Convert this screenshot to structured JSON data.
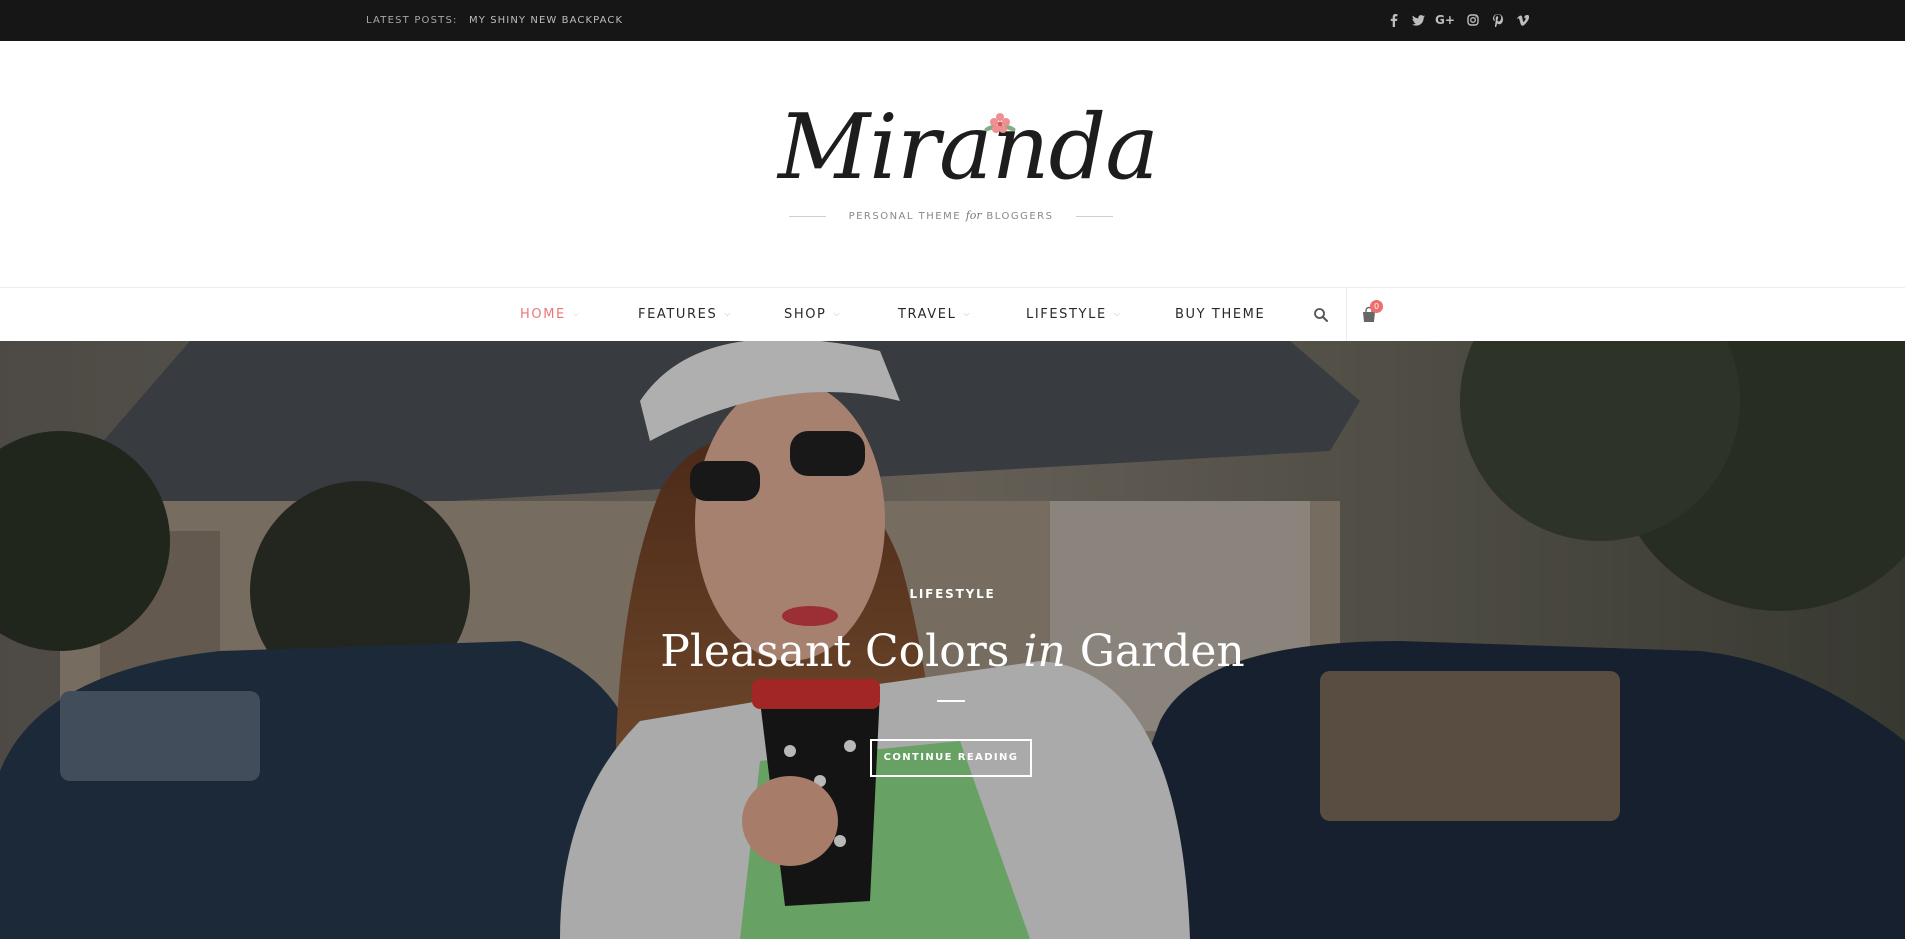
{
  "topbar": {
    "latest_label": "LATEST POSTS:",
    "latest_title": "MY SHINY NEW BACKPACK",
    "social": [
      {
        "icon": "facebook-icon",
        "glyph": "f"
      },
      {
        "icon": "twitter-icon",
        "glyph": "t"
      },
      {
        "icon": "google-plus-icon",
        "glyph": "G+"
      },
      {
        "icon": "instagram-icon",
        "glyph": ""
      },
      {
        "icon": "pinterest-icon",
        "glyph": "P"
      },
      {
        "icon": "vimeo-icon",
        "glyph": "v"
      }
    ]
  },
  "header": {
    "logo": "Miranda",
    "tagline_before": "PERSONAL THEME",
    "tagline_for": "for",
    "tagline_after": "BLOGGERS"
  },
  "nav": {
    "items": [
      {
        "label": "HOME",
        "dropdown": true,
        "active": true
      },
      {
        "label": "FEATURES",
        "dropdown": true
      },
      {
        "label": "SHOP",
        "dropdown": true
      },
      {
        "label": "TRAVEL",
        "dropdown": true
      },
      {
        "label": "LIFESTYLE",
        "dropdown": true
      },
      {
        "label": "BUY THEME",
        "dropdown": false
      }
    ],
    "chevron": "⌵",
    "cart_count": "0"
  },
  "hero": {
    "category": "LIFESTYLE",
    "title_before": "Pleasant Colors",
    "title_in": "in",
    "title_after": "Garden",
    "button_label": "CONTINUE READING"
  },
  "colors": {
    "accent": "#e9787b",
    "topbar_bg": "#161616",
    "badge": "#ef6d6d"
  }
}
